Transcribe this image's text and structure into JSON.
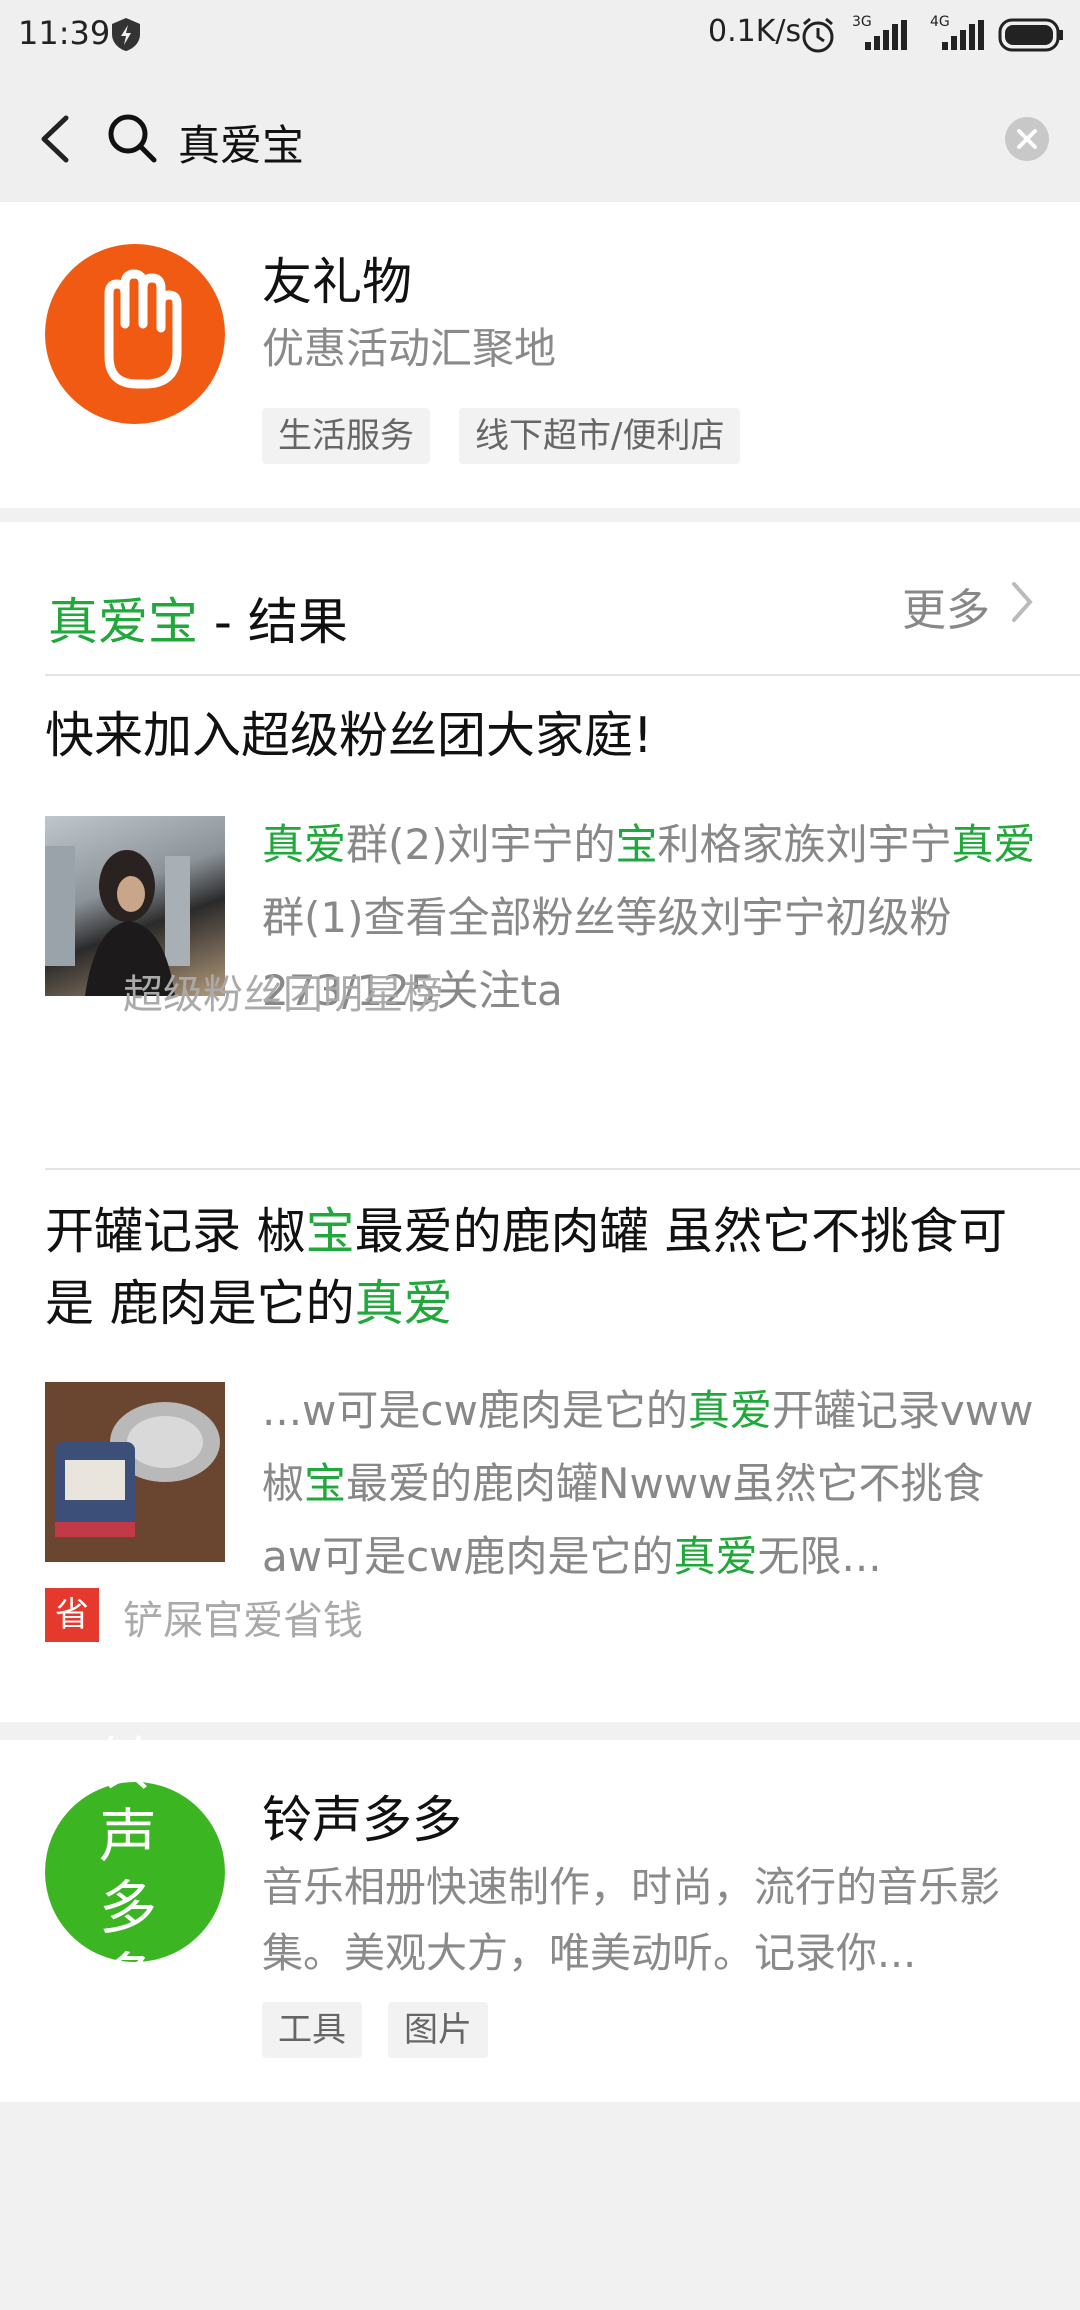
{
  "status": {
    "time": "11:39",
    "speed": "0.1K/s",
    "net1": "3G",
    "net2": "4G"
  },
  "search": {
    "query": "真爱宝"
  },
  "app1": {
    "name": "友礼物",
    "desc": "优惠活动汇聚地",
    "tags": [
      "生活服务",
      "线下超市/便利店"
    ],
    "icon_color": "#f05a12"
  },
  "section": {
    "keyword": "真爱宝",
    "suffix": " - 结果",
    "more_label": "更多"
  },
  "articles": [
    {
      "title": "快来加入超级粉丝团大家庭!",
      "snippet": [
        {
          "t": "真爱",
          "hl": true
        },
        {
          "t": "群(2)刘宇宁的",
          "hl": false
        },
        {
          "t": "宝",
          "hl": true
        },
        {
          "t": "利格家族刘宇宁",
          "hl": false
        },
        {
          "t": "真爱",
          "hl": true
        },
        {
          "t": "群(1)查看全部粉丝等级刘宇宁初级粉273/125关注ta",
          "hl": false
        }
      ],
      "source": "超级粉丝团明星榜"
    },
    {
      "title": [
        {
          "t": "开罐记录 椒",
          "hl": false
        },
        {
          "t": "宝",
          "hl": true
        },
        {
          "t": "最爱的鹿肉罐 虽然它不挑食可是 鹿肉是它的",
          "hl": false
        },
        {
          "t": "真爱",
          "hl": true
        }
      ],
      "snippet": [
        {
          "t": "...w可是cw鹿肉是它的",
          "hl": false
        },
        {
          "t": "真爱",
          "hl": true
        },
        {
          "t": "开罐记录vww椒",
          "hl": false
        },
        {
          "t": "宝",
          "hl": true
        },
        {
          "t": "最爱的鹿肉罐Nwww虽然它不挑食aw可是cw鹿肉是它的",
          "hl": false
        },
        {
          "t": "真爱",
          "hl": true
        },
        {
          "t": "无限...",
          "hl": false
        }
      ],
      "source": "铲屎官爱省钱",
      "source_badge": "省"
    }
  ],
  "app2": {
    "name": "铃声多多",
    "desc": "音乐相册快速制作，时尚，流行的音乐影集。美观大方，唯美动听。记录你...",
    "tags": [
      "工具",
      "图片"
    ],
    "icon_text": "铃声多多",
    "icon_color": "#3cb523"
  },
  "colors": {
    "highlight": "#21a83b"
  }
}
